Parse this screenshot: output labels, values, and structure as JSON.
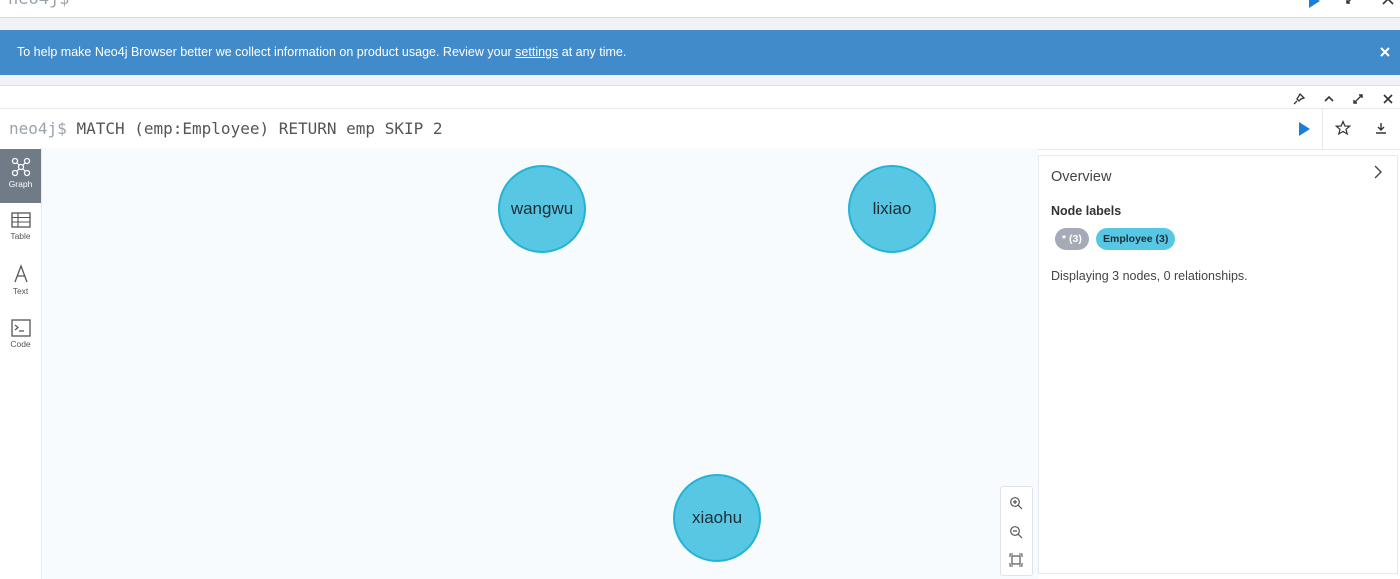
{
  "top_editor": {
    "prompt": "neo4j$"
  },
  "banner": {
    "text_before": "To help make Neo4j Browser better we collect information on product usage. Review your ",
    "link": "settings",
    "text_after": " at any time."
  },
  "query": {
    "prompt": "neo4j$",
    "command": "MATCH (emp:Employee) RETURN emp SKIP 2"
  },
  "views": [
    {
      "label": "Graph",
      "icon": "graph-icon",
      "active": true
    },
    {
      "label": "Table",
      "icon": "table-icon",
      "active": false
    },
    {
      "label": "Text",
      "icon": "text-icon",
      "active": false
    },
    {
      "label": "Code",
      "icon": "code-icon",
      "active": false
    }
  ],
  "nodes": [
    {
      "label": "wangwu"
    },
    {
      "label": "lixiao"
    },
    {
      "label": "xiaohu"
    }
  ],
  "overview": {
    "title": "Overview",
    "node_labels_heading": "Node labels",
    "pills": [
      {
        "label": "* (3)",
        "color": "#a5abb6"
      },
      {
        "label": "Employee (3)",
        "color": "#57c7e3"
      }
    ],
    "status": "Displaying 3 nodes, 0 relationships."
  },
  "colors": {
    "banner": "#428bca",
    "node_fill": "#57c7e3",
    "node_border": "#23b3d7",
    "run_button": "#1a7fd9",
    "active_view": "#707b87"
  }
}
